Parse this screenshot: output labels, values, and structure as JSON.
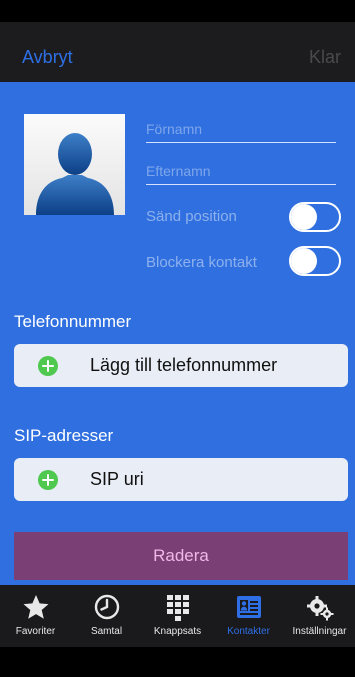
{
  "nav": {
    "cancel": "Avbryt",
    "done": "Klar"
  },
  "contact": {
    "first_name_placeholder": "Förnamn",
    "last_name_placeholder": "Efternamn"
  },
  "toggles": [
    {
      "label": "Sänd position",
      "on": false
    },
    {
      "label": "Blockera kontakt",
      "on": false
    }
  ],
  "phone_section": {
    "title": "Telefonnummer",
    "add_label": "Lägg till telefonnummer"
  },
  "sip_section": {
    "title": "SIP-adresser",
    "add_label": "SIP uri"
  },
  "delete_label": "Radera",
  "tabs": [
    {
      "label": "Favoriter",
      "icon": "star-icon"
    },
    {
      "label": "Samtal",
      "icon": "clock-icon"
    },
    {
      "label": "Knappsats",
      "icon": "keypad-icon"
    },
    {
      "label": "Kontakter",
      "icon": "contacts-icon",
      "active": true
    },
    {
      "label": "Inställningar",
      "icon": "gears-icon"
    }
  ],
  "colors": {
    "accent": "#2e6fe6",
    "content_bg": "#2f6fdf",
    "delete_bg": "#7a3f74",
    "add_icon": "#4fc84f"
  }
}
